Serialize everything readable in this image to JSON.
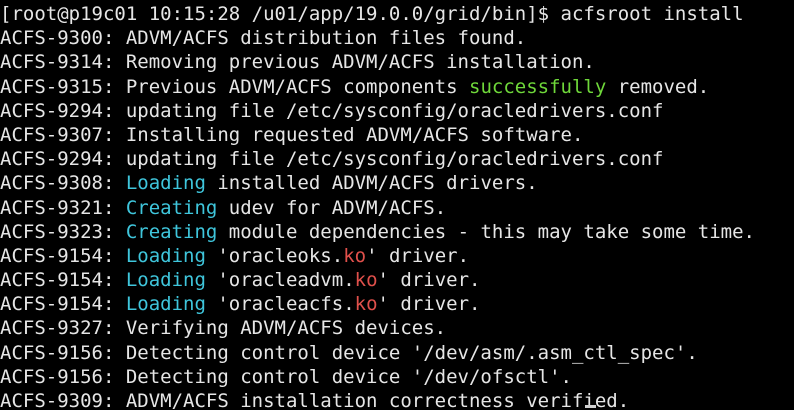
{
  "terminal": {
    "lines": [
      [
        {
          "text": "[root@p19c01 10:15:28 /u01/app/19.0.0/grid/bin]$ acfsroot install"
        }
      ],
      [
        {
          "text": "ACFS-9300: ADVM/ACFS distribution files found."
        }
      ],
      [
        {
          "text": "ACFS-9314: Removing previous ADVM/ACFS installation."
        }
      ],
      [
        {
          "text": "ACFS-9315: Previous ADVM/ACFS components "
        },
        {
          "text": "successfully",
          "color": "green"
        },
        {
          "text": " removed."
        }
      ],
      [
        {
          "text": "ACFS-9294: updating file /etc/sysconfig/oracledrivers.conf"
        }
      ],
      [
        {
          "text": "ACFS-9307: Installing requested ADVM/ACFS software."
        }
      ],
      [
        {
          "text": "ACFS-9294: updating file /etc/sysconfig/oracledrivers.conf"
        }
      ],
      [
        {
          "text": "ACFS-9308: "
        },
        {
          "text": "Loading",
          "color": "cyan"
        },
        {
          "text": " installed ADVM/ACFS drivers."
        }
      ],
      [
        {
          "text": "ACFS-9321: "
        },
        {
          "text": "Creating",
          "color": "cyan"
        },
        {
          "text": " udev for ADVM/ACFS."
        }
      ],
      [
        {
          "text": "ACFS-9323: "
        },
        {
          "text": "Creating",
          "color": "cyan"
        },
        {
          "text": " module dependencies - this may take some time."
        }
      ],
      [
        {
          "text": "ACFS-9154: "
        },
        {
          "text": "Loading",
          "color": "cyan"
        },
        {
          "text": " 'oracleoks."
        },
        {
          "text": "ko",
          "color": "red"
        },
        {
          "text": "' driver."
        }
      ],
      [
        {
          "text": "ACFS-9154: "
        },
        {
          "text": "Loading",
          "color": "cyan"
        },
        {
          "text": " 'oracleadvm."
        },
        {
          "text": "ko",
          "color": "red"
        },
        {
          "text": "' driver."
        }
      ],
      [
        {
          "text": "ACFS-9154: "
        },
        {
          "text": "Loading",
          "color": "cyan"
        },
        {
          "text": " 'oracleacfs."
        },
        {
          "text": "ko",
          "color": "red"
        },
        {
          "text": "' driver."
        }
      ],
      [
        {
          "text": "ACFS-9327: Verifying ADVM/ACFS devices."
        }
      ],
      [
        {
          "text": "ACFS-9156: Detecting control device '/dev/asm/.asm_ctl_spec'."
        }
      ],
      [
        {
          "text": "ACFS-9156: Detecting control device '/dev/ofsctl'."
        }
      ],
      [
        {
          "text": "ACFS-9309: ADVM/ACFS installation correctness verified."
        }
      ]
    ]
  },
  "colors": {
    "background": "#000000",
    "default": "#e6e6e6",
    "green": "#6fd83a",
    "cyan": "#3fc6dc",
    "red": "#e0504b"
  }
}
